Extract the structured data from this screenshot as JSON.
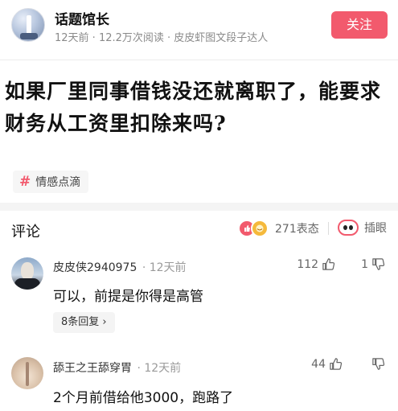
{
  "header": {
    "author_name": "话题馆长",
    "meta": "12天前 · 12.2万次阅读 · 皮皮虾图文段子达人",
    "follow_label": "关注"
  },
  "post": {
    "title": "如果厂里同事借钱没还就离职了，能要求财务从工资里扣除来吗?",
    "tag_icon": "#",
    "tag_label": "情感点滴"
  },
  "comments_section": {
    "title": "评论",
    "reaction_count": "271表态",
    "sticker_label": "插眼"
  },
  "comments": [
    {
      "user": "皮皮侠2940975",
      "time": "· 12天前",
      "likes": "112",
      "dislikes": "1",
      "text": "可以，前提是你得是高管",
      "replies": "8条回复 ›"
    },
    {
      "user": "舔王之王舔穿胃",
      "time": "· 12天前",
      "likes": "44",
      "dislikes": "",
      "text": "2个月前借给他3000，跑路了"
    }
  ],
  "colors": {
    "accent": "#f25a6d",
    "ha_reaction": "#f5b93b"
  }
}
